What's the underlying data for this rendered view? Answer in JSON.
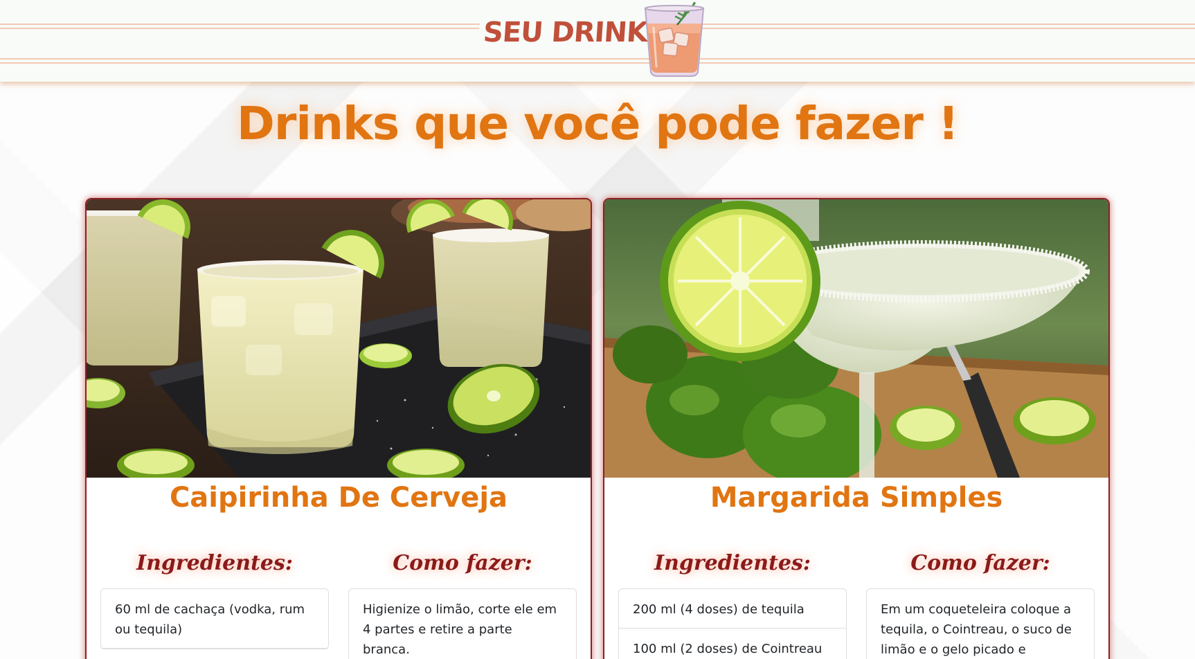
{
  "header": {
    "brand": "SEU DRINK",
    "logo_icon": "cocktail-glass-icon"
  },
  "page_title": "Drinks que você pode fazer !",
  "colors": {
    "title_orange": "#e17512",
    "heading_red": "#8b1a1a",
    "brand_red": "#c0503a",
    "card_border": "#8b1e25"
  },
  "cards": [
    {
      "image": "caipirinha-glasses-photo",
      "title": "Caipirinha De Cerveja",
      "ingredients_heading": "Ingredientes:",
      "method_heading": "Como fazer:",
      "ingredients": [
        "60 ml de cachaça (vodka, rum ou tequila)"
      ],
      "method": [
        "Higienize o limão, corte ele em 4 partes e retire a parte branca."
      ]
    },
    {
      "image": "margarita-glass-photo",
      "title": "Margarida Simples",
      "ingredients_heading": "Ingredientes:",
      "method_heading": "Como fazer:",
      "ingredients": [
        "200 ml (4 doses) de tequila",
        "100 ml (2 doses) de Cointreau"
      ],
      "method": [
        "Em um coqueteleira coloque a tequila, o Cointreau, o suco de limão e o gelo picado e"
      ]
    }
  ]
}
